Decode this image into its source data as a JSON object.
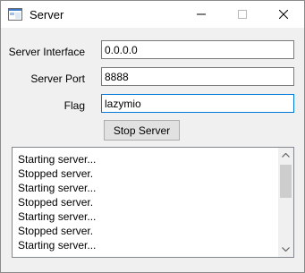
{
  "window": {
    "title": "Server"
  },
  "form": {
    "interface_label": "Server Interface",
    "interface_value": "0.0.0.0",
    "port_label": "Server Port",
    "port_value": "8888",
    "flag_label": "Flag",
    "flag_value": "lazymio",
    "stop_button_label": "Stop Server"
  },
  "log": {
    "lines": [
      "Starting server...",
      "Stopped server.",
      "Starting server...",
      "Stopped server.",
      "Starting server...",
      "Stopped server.",
      "Starting server..."
    ]
  },
  "icons": {
    "app": "window-app-icon",
    "minimize": "minimize-icon",
    "maximize": "maximize-icon",
    "close": "close-icon",
    "scroll_up": "chevron-up-icon",
    "scroll_down": "chevron-down-icon"
  },
  "colors": {
    "focus_border": "#0078d7",
    "titlebar": "#ffffff",
    "window_bg": "#f0f0f0"
  }
}
